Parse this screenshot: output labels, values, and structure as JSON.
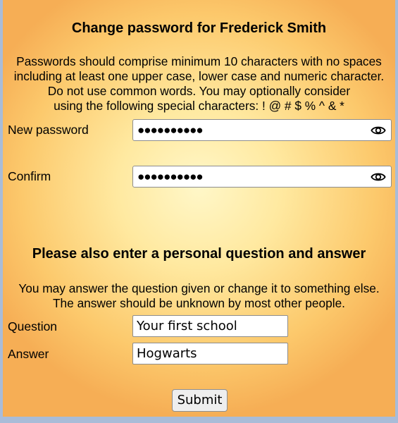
{
  "password_section": {
    "title": "Change password for Frederick Smith",
    "instructions": [
      "Passwords should comprise minimum 10 characters with no spaces",
      "including at least one upper case, lower case and numeric character.",
      "Do not use common words. You may optionally consider",
      "using the following special characters: ! @ # $ % ^ & *"
    ],
    "new_password": {
      "label": "New password",
      "masked_value": "●●●●●●●●●●",
      "icon": "eye-icon"
    },
    "confirm": {
      "label": "Confirm",
      "masked_value": "●●●●●●●●●●",
      "icon": "eye-icon"
    }
  },
  "question_section": {
    "title": "Please also enter a personal question and answer",
    "instructions": [
      "You may answer the question given or change it to something else.",
      "The answer should be unknown by most other people."
    ],
    "question": {
      "label": "Question",
      "value": "Your first school"
    },
    "answer": {
      "label": "Answer",
      "value": "Hogwarts"
    }
  },
  "submit_label": "Submit",
  "colors": {
    "background_edge": "#f6ae55",
    "background_center": "#fff7c8",
    "page_border": "#a9bcd8"
  }
}
